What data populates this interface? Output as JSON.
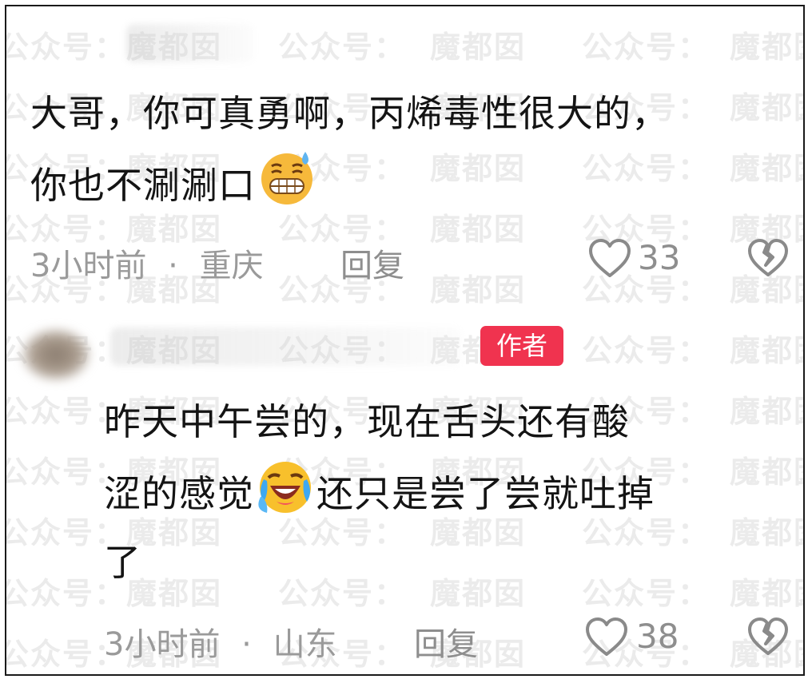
{
  "watermark": {
    "left_text": "公众号：",
    "right_text": "魔都囡"
  },
  "comments": [
    {
      "line1": "大哥，你可真勇啊，丙烯毒性很大的，",
      "line2": "你也不涮涮口",
      "emoji": "grimacing-sweat-emoji",
      "time": "3小时前",
      "separator": "·",
      "location": "重庆",
      "reply_label": "回复",
      "likes": "33"
    },
    {
      "badge": "作者",
      "line1": "昨天中午尝的，现在舌头还有酸",
      "line2a": "涩的感觉",
      "emoji": "rofl-crying-emoji",
      "line2b": "还只是尝了尝就吐掉",
      "line3": "了",
      "time": "3小时前",
      "separator": "·",
      "location": "山东",
      "reply_label": "回复",
      "likes": "38"
    }
  ],
  "icons": {
    "like": "heart-outline-icon",
    "dislike": "broken-heart-icon"
  },
  "colors": {
    "badge": "#f0334f",
    "text": "#141414",
    "meta": "#9a9a9a"
  }
}
